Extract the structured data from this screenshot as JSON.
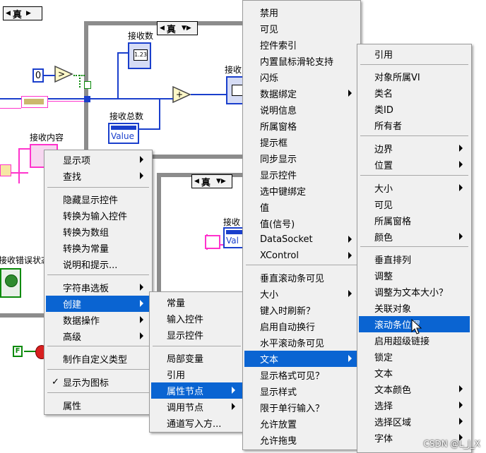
{
  "diagram": {
    "case_label": "真",
    "labels": {
      "recv_count_1": "接收数",
      "recv_count_2": "接收",
      "recv_total": "接收总数",
      "recv_content": "接收内容",
      "recv_error": "接收错误状态",
      "recv_4": "接收"
    },
    "const_zero": "0",
    "numeric_display": "1.23",
    "value_text": "Value",
    "value_text_2": "Val",
    "bool_f": "F"
  },
  "menu1": {
    "items": [
      {
        "label": "显示项",
        "arrow": true
      },
      {
        "label": "查找",
        "arrow": true
      },
      {
        "label": "隐藏显示控件"
      },
      {
        "label": "转换为输入控件"
      },
      {
        "label": "转换为数组"
      },
      {
        "label": "转换为常量"
      },
      {
        "label": "说明和提示..."
      },
      {
        "label": "字符串选板",
        "arrow": true
      },
      {
        "label": "创建",
        "arrow": true,
        "selected": true
      },
      {
        "label": "数据操作",
        "arrow": true
      },
      {
        "label": "高级",
        "arrow": true
      },
      {
        "label": "制作自定义类型"
      },
      {
        "label": "显示为图标",
        "checked": true
      },
      {
        "label": "属性"
      }
    ]
  },
  "menu2": {
    "items": [
      {
        "label": "常量"
      },
      {
        "label": "输入控件"
      },
      {
        "label": "显示控件"
      },
      {
        "label": "局部变量"
      },
      {
        "label": "引用"
      },
      {
        "label": "属性节点",
        "arrow": true,
        "selected": true
      },
      {
        "label": "调用节点",
        "arrow": true
      },
      {
        "label": "通道写入方..."
      }
    ]
  },
  "menu3": {
    "items": [
      {
        "label": "禁用"
      },
      {
        "label": "可见"
      },
      {
        "label": "控件索引"
      },
      {
        "label": "内置鼠标滑轮支持"
      },
      {
        "label": "闪烁"
      },
      {
        "label": "数据绑定",
        "arrow": true
      },
      {
        "label": "说明信息"
      },
      {
        "label": "所属窗格"
      },
      {
        "label": "提示框"
      },
      {
        "label": "同步显示"
      },
      {
        "label": "显示控件"
      },
      {
        "label": "选中键绑定"
      },
      {
        "label": "值"
      },
      {
        "label": "值(信号)"
      },
      {
        "label": "DataSocket",
        "arrow": true
      },
      {
        "label": "XControl",
        "arrow": true
      },
      {
        "label": "垂直滚动条可见"
      },
      {
        "label": "大小",
        "arrow": true
      },
      {
        "label": "键入时刷新？"
      },
      {
        "label": "启用自动换行"
      },
      {
        "label": "水平滚动条可见"
      },
      {
        "label": "文本",
        "arrow": true,
        "selected": true
      },
      {
        "label": "显示格式可见？"
      },
      {
        "label": "显示样式"
      },
      {
        "label": "限于单行输入？"
      },
      {
        "label": "允许放置"
      },
      {
        "label": "允许拖曳"
      }
    ]
  },
  "menu4": {
    "items": [
      {
        "label": "引用"
      },
      {
        "label": "对象所属VI"
      },
      {
        "label": "类名"
      },
      {
        "label": "类ID"
      },
      {
        "label": "所有者"
      },
      {
        "label": "边界",
        "arrow": true
      },
      {
        "label": "位置",
        "arrow": true
      },
      {
        "label": "大小",
        "arrow": true
      },
      {
        "label": "可见"
      },
      {
        "label": "所属窗格"
      },
      {
        "label": "颜色",
        "arrow": true
      },
      {
        "label": "垂直排列"
      },
      {
        "label": "调整"
      },
      {
        "label": "调整为文本大小？"
      },
      {
        "label": "关联对象"
      },
      {
        "label": "滚动条位置",
        "selected": true
      },
      {
        "label": "启用超级链接"
      },
      {
        "label": "锁定"
      },
      {
        "label": "文本"
      },
      {
        "label": "文本颜色",
        "arrow": true
      },
      {
        "label": "选择",
        "arrow": true
      },
      {
        "label": "选择区域",
        "arrow": true
      },
      {
        "label": "字体",
        "arrow": true
      }
    ]
  },
  "watermark": "CSDN @L_J_X"
}
